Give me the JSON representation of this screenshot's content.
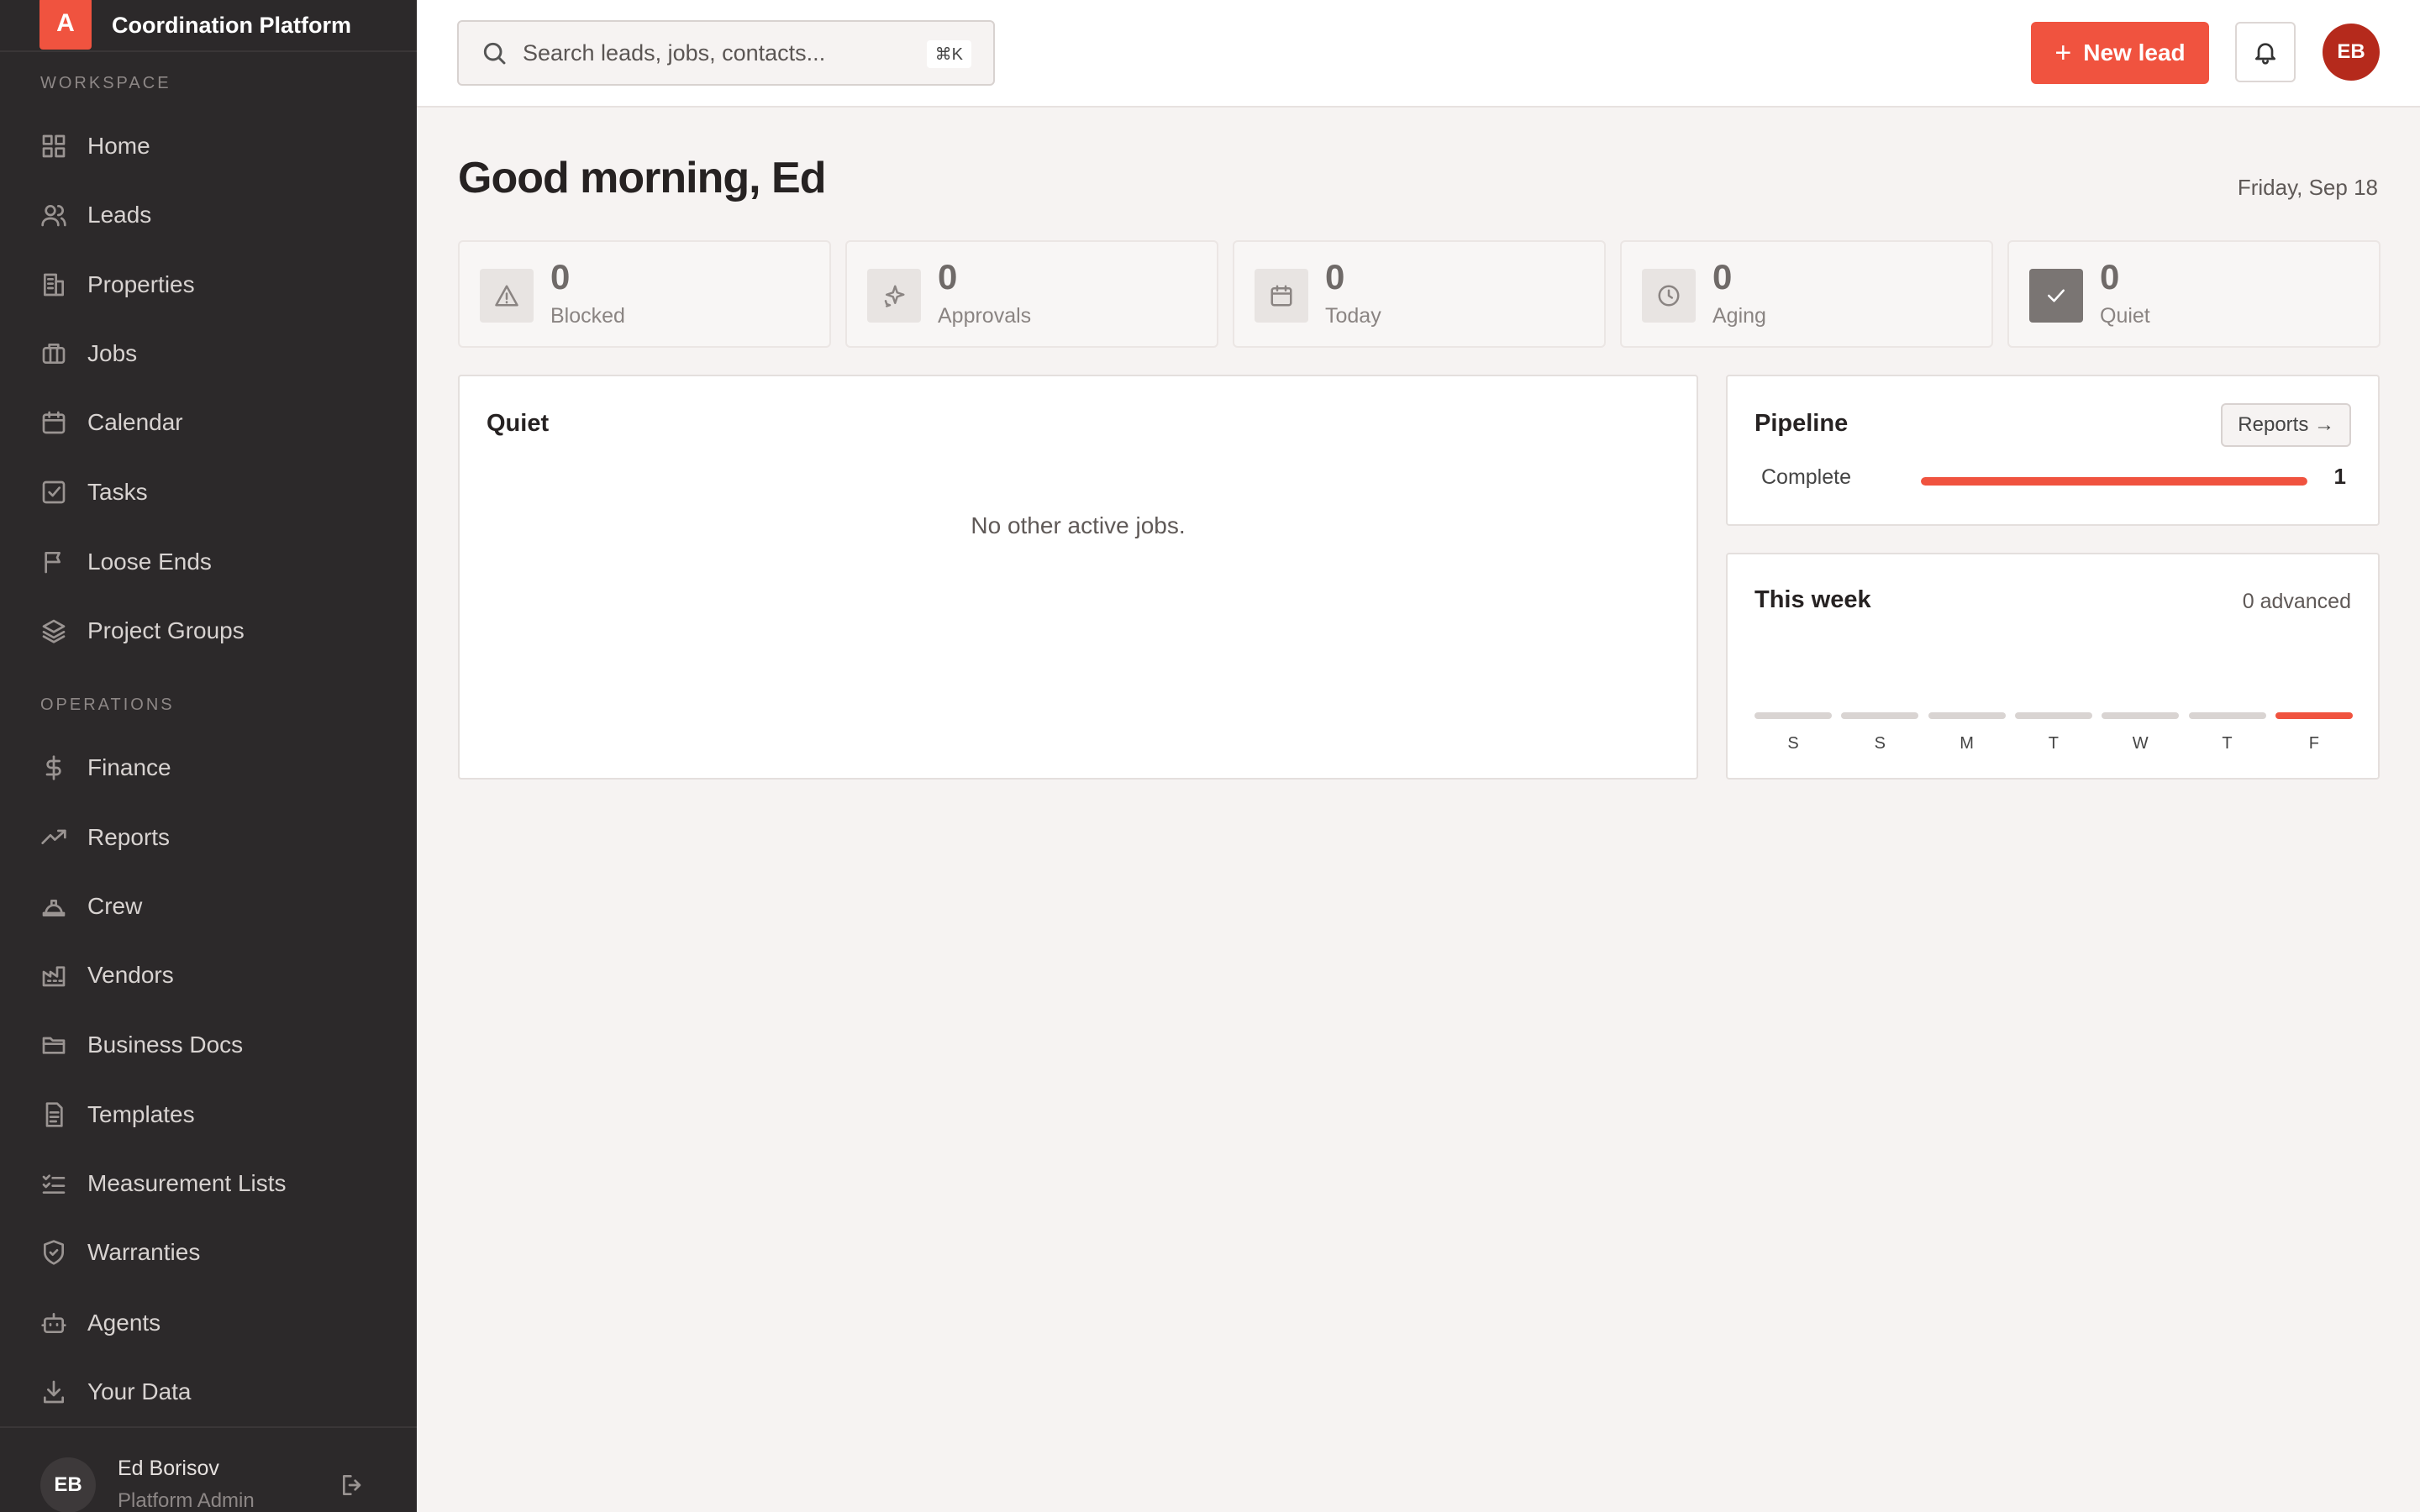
{
  "brand": {
    "logo_letter": "A",
    "name": "Coordination Platform",
    "accent": "#f0533f"
  },
  "sidebar": {
    "workspace_label": "WORKSPACE",
    "operations_label": "OPERATIONS",
    "workspace_items": [
      {
        "label": "Home",
        "icon": "grid-icon"
      },
      {
        "label": "Leads",
        "icon": "users-icon"
      },
      {
        "label": "Properties",
        "icon": "building-icon"
      },
      {
        "label": "Jobs",
        "icon": "briefcase-icon"
      },
      {
        "label": "Calendar",
        "icon": "calendar-icon"
      },
      {
        "label": "Tasks",
        "icon": "checkbox-icon"
      },
      {
        "label": "Loose Ends",
        "icon": "flag-icon"
      },
      {
        "label": "Project Groups",
        "icon": "layers-icon"
      }
    ],
    "operations_items": [
      {
        "label": "Finance",
        "icon": "dollar-icon"
      },
      {
        "label": "Reports",
        "icon": "trending-icon"
      },
      {
        "label": "Crew",
        "icon": "hardhat-icon"
      },
      {
        "label": "Vendors",
        "icon": "factory-icon"
      },
      {
        "label": "Business Docs",
        "icon": "folder-icon"
      },
      {
        "label": "Templates",
        "icon": "document-icon"
      },
      {
        "label": "Measurement Lists",
        "icon": "list-check-icon"
      },
      {
        "label": "Warranties",
        "icon": "shield-icon"
      },
      {
        "label": "Agents",
        "icon": "robot-icon"
      },
      {
        "label": "Your Data",
        "icon": "download-icon"
      }
    ],
    "user": {
      "initials": "EB",
      "name": "Ed Borisov",
      "role": "Platform Admin"
    }
  },
  "topbar": {
    "search_placeholder": "Search leads, jobs, contacts...",
    "search_shortcut": "⌘K",
    "new_lead_label": "New lead",
    "avatar_initials": "EB"
  },
  "main": {
    "greeting": "Good morning, Ed",
    "date": "Friday, Sep 18",
    "stats": [
      {
        "value": "0",
        "label": "Blocked",
        "icon": "alert-triangle-icon"
      },
      {
        "value": "0",
        "label": "Approvals",
        "icon": "sparkle-icon"
      },
      {
        "value": "0",
        "label": "Today",
        "icon": "calendar-icon"
      },
      {
        "value": "0",
        "label": "Aging",
        "icon": "clock-icon"
      },
      {
        "value": "0",
        "label": "Quiet",
        "icon": "check-icon"
      }
    ],
    "quiet_card": {
      "title": "Quiet",
      "empty_text": "No other active jobs."
    },
    "pipeline": {
      "title": "Pipeline",
      "reports_label": "Reports →",
      "rows": [
        {
          "label": "Complete",
          "count": "1",
          "fraction": 1.0
        }
      ]
    },
    "week": {
      "title": "This week",
      "subtitle": "0 advanced",
      "days": [
        "S",
        "S",
        "M",
        "T",
        "W",
        "T",
        "F"
      ],
      "active_index": 6
    }
  }
}
